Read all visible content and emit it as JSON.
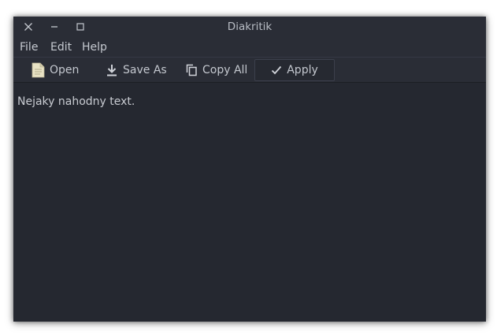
{
  "window": {
    "title": "Diakritik",
    "controls": {
      "close": "close-icon",
      "minimize": "minimize-icon",
      "maximize": "maximize-icon"
    }
  },
  "menubar": {
    "items": [
      {
        "label": "File"
      },
      {
        "label": "Edit"
      },
      {
        "label": "Help"
      }
    ]
  },
  "toolbar": {
    "open": {
      "label": "Open",
      "icon": "document-icon"
    },
    "save_as": {
      "label": "Save As",
      "icon": "download-icon"
    },
    "copy_all": {
      "label": "Copy All",
      "icon": "copy-icon"
    },
    "apply": {
      "label": "Apply",
      "icon": "checkmark-icon"
    }
  },
  "editor": {
    "text": "Nejaky nahodny text."
  },
  "colors": {
    "background": "#252830",
    "bars": "#2a2d36",
    "text": "#c4c8cf",
    "document_icon": "#e8e2c4"
  }
}
